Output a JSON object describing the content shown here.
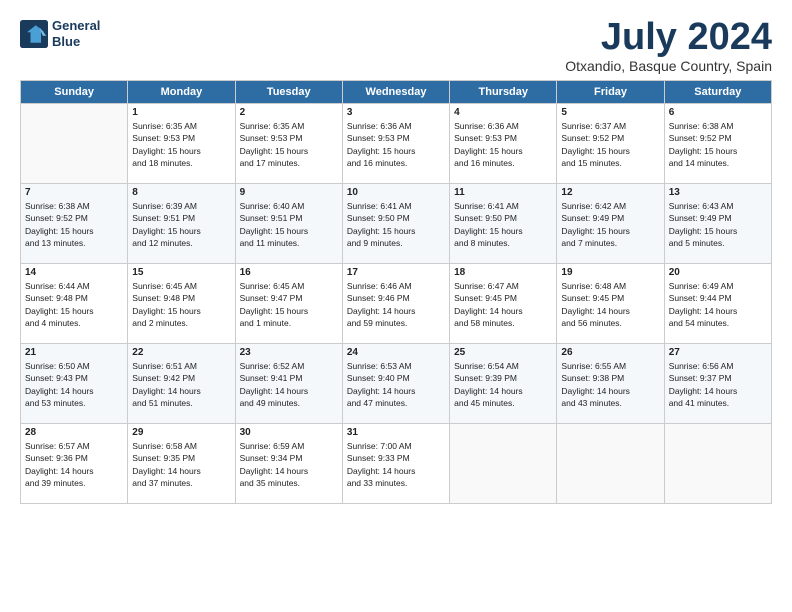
{
  "logo": {
    "line1": "General",
    "line2": "Blue"
  },
  "title": "July 2024",
  "location": "Otxandio, Basque Country, Spain",
  "days_of_week": [
    "Sunday",
    "Monday",
    "Tuesday",
    "Wednesday",
    "Thursday",
    "Friday",
    "Saturday"
  ],
  "weeks": [
    [
      {
        "day": "",
        "info": ""
      },
      {
        "day": "1",
        "info": "Sunrise: 6:35 AM\nSunset: 9:53 PM\nDaylight: 15 hours\nand 18 minutes."
      },
      {
        "day": "2",
        "info": "Sunrise: 6:35 AM\nSunset: 9:53 PM\nDaylight: 15 hours\nand 17 minutes."
      },
      {
        "day": "3",
        "info": "Sunrise: 6:36 AM\nSunset: 9:53 PM\nDaylight: 15 hours\nand 16 minutes."
      },
      {
        "day": "4",
        "info": "Sunrise: 6:36 AM\nSunset: 9:53 PM\nDaylight: 15 hours\nand 16 minutes."
      },
      {
        "day": "5",
        "info": "Sunrise: 6:37 AM\nSunset: 9:52 PM\nDaylight: 15 hours\nand 15 minutes."
      },
      {
        "day": "6",
        "info": "Sunrise: 6:38 AM\nSunset: 9:52 PM\nDaylight: 15 hours\nand 14 minutes."
      }
    ],
    [
      {
        "day": "7",
        "info": "Sunrise: 6:38 AM\nSunset: 9:52 PM\nDaylight: 15 hours\nand 13 minutes."
      },
      {
        "day": "8",
        "info": "Sunrise: 6:39 AM\nSunset: 9:51 PM\nDaylight: 15 hours\nand 12 minutes."
      },
      {
        "day": "9",
        "info": "Sunrise: 6:40 AM\nSunset: 9:51 PM\nDaylight: 15 hours\nand 11 minutes."
      },
      {
        "day": "10",
        "info": "Sunrise: 6:41 AM\nSunset: 9:50 PM\nDaylight: 15 hours\nand 9 minutes."
      },
      {
        "day": "11",
        "info": "Sunrise: 6:41 AM\nSunset: 9:50 PM\nDaylight: 15 hours\nand 8 minutes."
      },
      {
        "day": "12",
        "info": "Sunrise: 6:42 AM\nSunset: 9:49 PM\nDaylight: 15 hours\nand 7 minutes."
      },
      {
        "day": "13",
        "info": "Sunrise: 6:43 AM\nSunset: 9:49 PM\nDaylight: 15 hours\nand 5 minutes."
      }
    ],
    [
      {
        "day": "14",
        "info": "Sunrise: 6:44 AM\nSunset: 9:48 PM\nDaylight: 15 hours\nand 4 minutes."
      },
      {
        "day": "15",
        "info": "Sunrise: 6:45 AM\nSunset: 9:48 PM\nDaylight: 15 hours\nand 2 minutes."
      },
      {
        "day": "16",
        "info": "Sunrise: 6:45 AM\nSunset: 9:47 PM\nDaylight: 15 hours\nand 1 minute."
      },
      {
        "day": "17",
        "info": "Sunrise: 6:46 AM\nSunset: 9:46 PM\nDaylight: 14 hours\nand 59 minutes."
      },
      {
        "day": "18",
        "info": "Sunrise: 6:47 AM\nSunset: 9:45 PM\nDaylight: 14 hours\nand 58 minutes."
      },
      {
        "day": "19",
        "info": "Sunrise: 6:48 AM\nSunset: 9:45 PM\nDaylight: 14 hours\nand 56 minutes."
      },
      {
        "day": "20",
        "info": "Sunrise: 6:49 AM\nSunset: 9:44 PM\nDaylight: 14 hours\nand 54 minutes."
      }
    ],
    [
      {
        "day": "21",
        "info": "Sunrise: 6:50 AM\nSunset: 9:43 PM\nDaylight: 14 hours\nand 53 minutes."
      },
      {
        "day": "22",
        "info": "Sunrise: 6:51 AM\nSunset: 9:42 PM\nDaylight: 14 hours\nand 51 minutes."
      },
      {
        "day": "23",
        "info": "Sunrise: 6:52 AM\nSunset: 9:41 PM\nDaylight: 14 hours\nand 49 minutes."
      },
      {
        "day": "24",
        "info": "Sunrise: 6:53 AM\nSunset: 9:40 PM\nDaylight: 14 hours\nand 47 minutes."
      },
      {
        "day": "25",
        "info": "Sunrise: 6:54 AM\nSunset: 9:39 PM\nDaylight: 14 hours\nand 45 minutes."
      },
      {
        "day": "26",
        "info": "Sunrise: 6:55 AM\nSunset: 9:38 PM\nDaylight: 14 hours\nand 43 minutes."
      },
      {
        "day": "27",
        "info": "Sunrise: 6:56 AM\nSunset: 9:37 PM\nDaylight: 14 hours\nand 41 minutes."
      }
    ],
    [
      {
        "day": "28",
        "info": "Sunrise: 6:57 AM\nSunset: 9:36 PM\nDaylight: 14 hours\nand 39 minutes."
      },
      {
        "day": "29",
        "info": "Sunrise: 6:58 AM\nSunset: 9:35 PM\nDaylight: 14 hours\nand 37 minutes."
      },
      {
        "day": "30",
        "info": "Sunrise: 6:59 AM\nSunset: 9:34 PM\nDaylight: 14 hours\nand 35 minutes."
      },
      {
        "day": "31",
        "info": "Sunrise: 7:00 AM\nSunset: 9:33 PM\nDaylight: 14 hours\nand 33 minutes."
      },
      {
        "day": "",
        "info": ""
      },
      {
        "day": "",
        "info": ""
      },
      {
        "day": "",
        "info": ""
      }
    ]
  ]
}
